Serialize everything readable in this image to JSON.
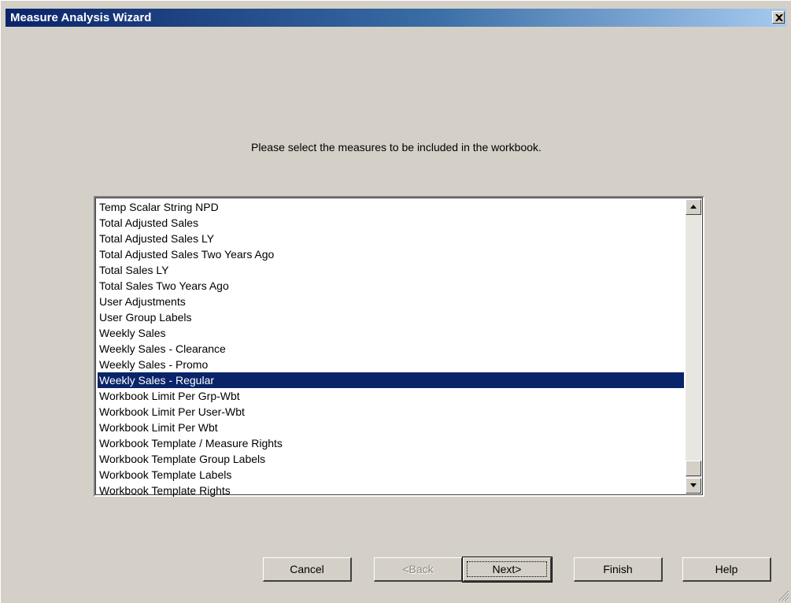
{
  "window": {
    "title": "Measure Analysis Wizard"
  },
  "instruction": "Please select the measures to be included in the workbook.",
  "measures": {
    "items": [
      "Temp Scalar String NPD",
      "Total Adjusted Sales",
      "Total Adjusted Sales LY",
      "Total Adjusted Sales Two Years Ago",
      "Total Sales LY",
      "Total Sales Two Years Ago",
      "User Adjustments",
      "User Group Labels",
      "Weekly Sales",
      "Weekly Sales - Clearance",
      "Weekly Sales - Promo",
      "Weekly Sales - Regular",
      "Workbook Limit Per Grp-Wbt",
      "Workbook Limit Per User-Wbt",
      "Workbook Limit Per Wbt",
      "Workbook Template / Measure Rights",
      "Workbook Template Group Labels",
      "Workbook Template Labels",
      "Workbook Template Rights"
    ],
    "selected": "Weekly Sales - Regular"
  },
  "buttons": {
    "cancel": "Cancel",
    "back": "<Back",
    "next": "Next>",
    "finish": "Finish",
    "help": "Help"
  },
  "colors": {
    "selection": "#0a246a",
    "face": "#d4d0c8"
  }
}
